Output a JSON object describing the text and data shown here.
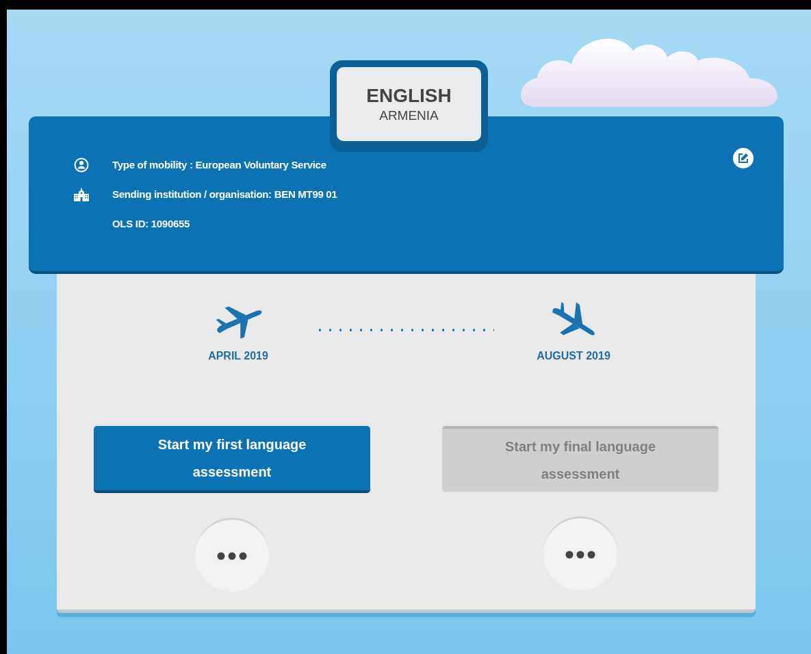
{
  "language": {
    "name": "ENGLISH",
    "country": "ARMENIA"
  },
  "details": [
    {
      "kind": "person",
      "text": "Type of mobility : European Voluntary Service"
    },
    {
      "kind": "building",
      "text": "Sending institution / organisation: BEN MT99 01"
    },
    {
      "kind": "plain",
      "text": "OLS ID: 1090655"
    }
  ],
  "timeline": [
    {
      "kind": "departure",
      "label": "APRIL 2019"
    },
    {
      "kind": "arrival",
      "label": "AUGUST 2019"
    }
  ],
  "assessments": [
    {
      "label": "Start my first language assessment",
      "disabled": false
    },
    {
      "label": "Start my final language assessment",
      "disabled": true
    }
  ]
}
